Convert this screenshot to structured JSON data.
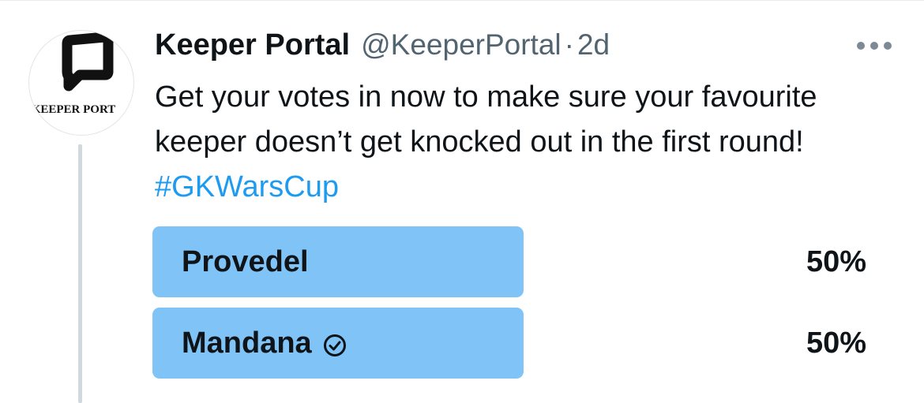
{
  "tweet": {
    "display_name": "Keeper Portal",
    "handle": "@KeeperPortal",
    "separator": "·",
    "time": "2d",
    "text_before_hashtag": "Get your votes in now to make sure your favourite keeper doesn’t get knocked out in the first round! ",
    "hashtag": "#GKWarsCup"
  },
  "avatar": {
    "logo_text": "KEEPER PORTAL"
  },
  "poll": {
    "options": [
      {
        "label": "Provedel",
        "percent_text": "50%",
        "fraction": 0.5,
        "selected": false
      },
      {
        "label": "Mandana",
        "percent_text": "50%",
        "fraction": 0.5,
        "selected": true
      }
    ]
  },
  "colors": {
    "poll_bar": "#80c4f7",
    "hashtag": "#1d9bf0",
    "secondary_text": "#536471",
    "primary_text": "#0f1419"
  }
}
